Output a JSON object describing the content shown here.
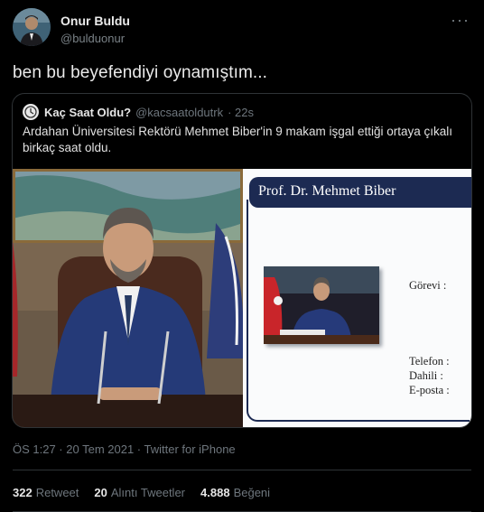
{
  "tweet": {
    "author_name": "Onur Buldu",
    "author_handle": "@bulduonur",
    "more_label": "···",
    "text": "ben bu beyefendiyi oynamıştım...",
    "timestamp": "ÖS 1:27 · 20 Tem 2021 · Twitter for iPhone"
  },
  "quote": {
    "author_name": "Kaç Saat Oldu?",
    "author_handle": "@kacsaatoldutrk",
    "time_ago": "· 22s",
    "text": "Ardahan Üniversitesi Rektörü Mehmet Biber'in 9 makam işgal ettiği ortaya çıkalı birkaç saat oldu.",
    "card": {
      "title": "Prof. Dr. Mehmet Biber",
      "gorevi": "Görevi :",
      "telefon": "Telefon :",
      "dahili": "Dahili :",
      "eposta": "E-posta :"
    }
  },
  "stats": {
    "retweet_count": "322",
    "retweet_label": "Retweet",
    "quote_count": "20",
    "quote_label": "Alıntı Tweetler",
    "like_count": "4.888",
    "like_label": "Beğeni"
  },
  "icons": {
    "avatar": "avatar-photo",
    "quote_avatar": "clock-icon",
    "more": "more-icon"
  },
  "colors": {
    "background": "#000000",
    "card_navy": "#1c2a52",
    "secondary_text": "#6e767d"
  }
}
